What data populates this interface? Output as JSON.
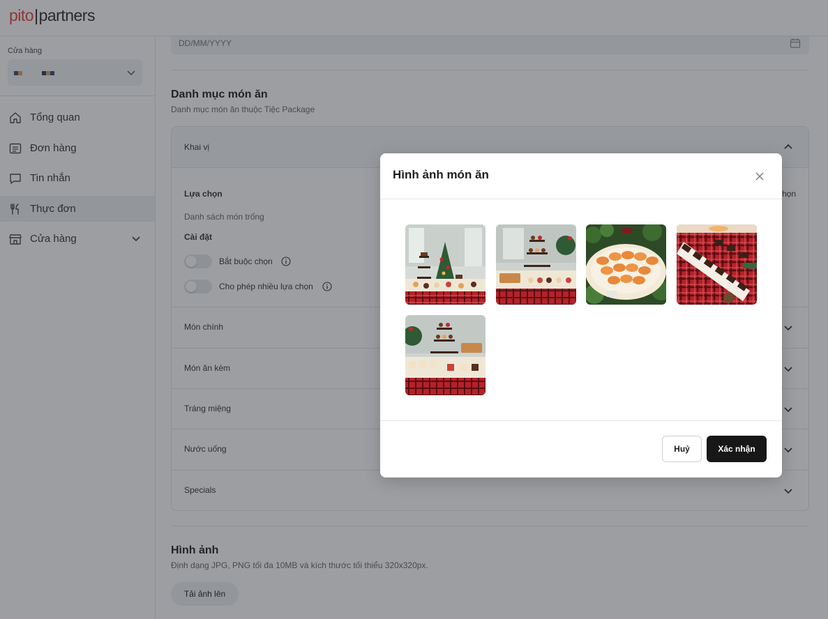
{
  "header": {
    "logo_left": "pito",
    "logo_sep": "|",
    "logo_right": "partners"
  },
  "sidebar": {
    "store_label": "Cửa hàng",
    "nav": [
      {
        "label": "Tổng quan",
        "icon": "home-icon"
      },
      {
        "label": "Đơn hàng",
        "icon": "receipt-icon"
      },
      {
        "label": "Tin nhắn",
        "icon": "chat-icon"
      },
      {
        "label": "Thực đơn",
        "icon": "fork-knife-icon",
        "active": true
      },
      {
        "label": "Cửa hàng",
        "icon": "store-icon",
        "expandable": true
      }
    ]
  },
  "main": {
    "date_placeholder": "DD/MM/YYYY",
    "category_title": "Danh mục món ăn",
    "category_subtitle": "Danh mục món ăn thuộc Tiệc Package",
    "accordion": {
      "open_section": "Khai vị",
      "choice_label": "Lựa chọn",
      "choice_right": "họn",
      "empty_list": "Danh sách món trống",
      "settings_label": "Cài đặt",
      "toggle_required": "Bắt buộc chọn",
      "toggle_multiple": "Cho phép nhiều lựa chọn",
      "sections": [
        "Món chính",
        "Món ăn kèm",
        "Tráng miệng",
        "Nước uống",
        "Specials"
      ]
    },
    "image_title": "Hình ảnh",
    "image_subtitle": "Định dạng JPG, PNG tối đa 10MB và kích thước tối thiểu 320x320px.",
    "upload_label": "Tải ảnh lên"
  },
  "modal": {
    "title": "Hình ảnh món ăn",
    "images": [
      "food-photo-1",
      "food-photo-2",
      "food-photo-3",
      "food-photo-4",
      "food-photo-5"
    ],
    "cancel_label": "Huỷ",
    "confirm_label": "Xác nhận"
  },
  "colors": {
    "brand_red": "#e8423c",
    "confirm_bg": "#171717",
    "sidebar_active": "#eef0f2"
  }
}
